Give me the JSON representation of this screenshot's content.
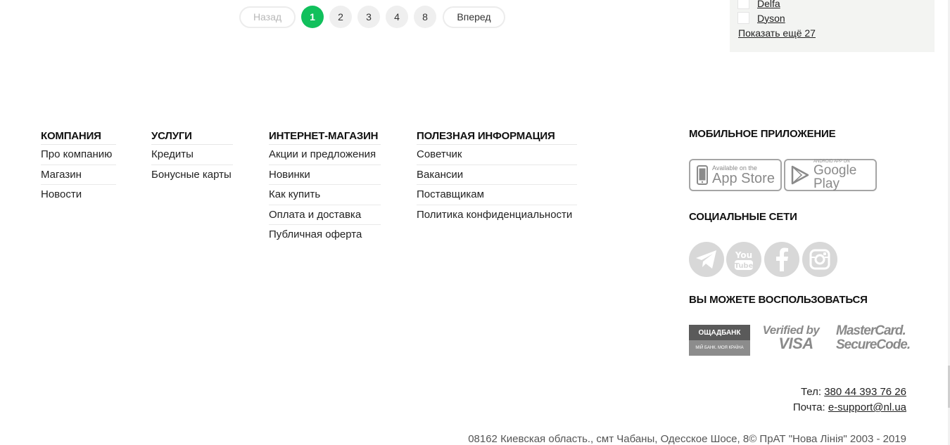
{
  "pagination": {
    "prev": "Назад",
    "pages": [
      "1",
      "2",
      "3",
      "4",
      "8"
    ],
    "next": "Вперед"
  },
  "filter": {
    "items": [
      "Delfa",
      "Dyson"
    ],
    "show_more": "Показать ещё 27"
  },
  "footer": {
    "columns": [
      {
        "title": "КОМПАНИЯ",
        "links": [
          "Про компанию",
          "Магазин",
          "Новости"
        ]
      },
      {
        "title": "УСЛУГИ",
        "links": [
          "Кредиты",
          "Бонусные карты"
        ]
      },
      {
        "title": "ИНТЕРНЕТ-МАГАЗИН",
        "links": [
          "Акции и предложения",
          "Новинки",
          "Как купить",
          "Оплата и доставка",
          "Публичная оферта"
        ]
      },
      {
        "title": "ПОЛЕЗНАЯ ИНФОРМАЦИЯ",
        "links": [
          "Советчик",
          "Вакансии",
          "Поставщикам",
          "Политика конфиденциальности"
        ]
      }
    ],
    "mobile_app": {
      "title": "МОБИЛЬНОЕ ПРИЛОЖЕНИЕ",
      "appstore_small": "Available on the",
      "appstore_big": "App Store",
      "googleplay_small": "ANDROID APP ON",
      "googleplay_big": "Google Play"
    },
    "social": {
      "title": "СОЦИАЛЬНЫЕ СЕТИ"
    },
    "payments": {
      "title": "ВЫ МОЖЕТЕ ВОСПОЛЬЗОВАТЬСЯ",
      "oschad_top": "ОЩАДБАНК",
      "oschad_bottom": "МІЙ БАНК. МОЯ КРАЇНА",
      "visa_line1": "Verified by",
      "visa_line2": "VISA",
      "mc_line1": "MasterCard.",
      "mc_line2": "SecureCode."
    },
    "contacts": {
      "phone_label": "Тел:",
      "phone": "380 44 393 76 26",
      "email_label": "Почта:",
      "email": "e-support@nl.ua"
    },
    "address": "08162 Киевская область., смт Чабаны, Одесское Шосе, 8© ПрАТ \"Нова Лінія\" 2003 - 2019"
  },
  "colors": {
    "accent": "#11c05c",
    "panel_bg": "#f3f4f2",
    "icon_gray": "#d8d8d8"
  }
}
